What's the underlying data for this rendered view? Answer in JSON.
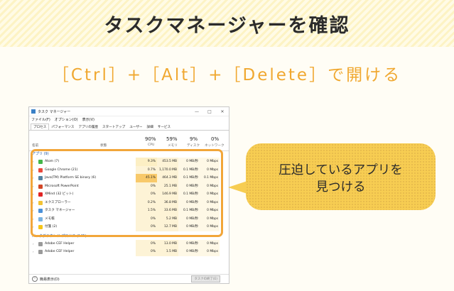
{
  "header": {
    "title": "タスクマネージャーを確認"
  },
  "shortcut": {
    "text": "［Ctrl］+［Alt］+［Delete］で開ける"
  },
  "callout": {
    "text": "圧迫しているアプリを\n見つける"
  },
  "taskmanager": {
    "window_title": "タスク マネージャー",
    "window_controls": [
      "—",
      "□",
      "✕"
    ],
    "menu": [
      "ファイル(F)",
      "オプション(O)",
      "表示(V)"
    ],
    "tabs": [
      "プロセス",
      "パフォーマンス",
      "アプリの履歴",
      "スタートアップ",
      "ユーザー",
      "詳細",
      "サービス"
    ],
    "columns": {
      "name": "名前",
      "status": "状態",
      "cpu": {
        "percent": "90%",
        "label": "CPU"
      },
      "memory": {
        "percent": "59%",
        "label": "メモリ"
      },
      "disk": {
        "percent": "9%",
        "label": "ディスク"
      },
      "network": {
        "percent": "0%",
        "label": "ネットワーク"
      }
    },
    "apps_group": "アプリ (9)",
    "apps": [
      {
        "name": "Atom (7)",
        "cpu": "9.3%",
        "mem": "453.5 MB",
        "disk": "0 MB/秒",
        "net": "0 Mbps",
        "icon_color": "#43b649",
        "cpu_bg": "#fcefc4"
      },
      {
        "name": "Google Chrome (21)",
        "cpu": "0.7%",
        "mem": "1,170.0 MB",
        "disk": "0.1 MB/秒",
        "net": "0 Mbps",
        "icon_color": "#e9483b",
        "cpu_bg": "#fdf3d6"
      },
      {
        "name": "Java(TM) Platform SE binary (6)",
        "cpu": "45.1%",
        "mem": "464.3 MB",
        "disk": "0.1 MB/秒",
        "net": "0.1 Mbps",
        "icon_color": "#5382a1",
        "cpu_bg": "#f8c96a"
      },
      {
        "name": "Microsoft PowerPoint",
        "cpu": "0%",
        "mem": "25.1 MB",
        "disk": "0 MB/秒",
        "net": "0 Mbps",
        "icon_color": "#d24726",
        "cpu_bg": "#fdf3d6"
      },
      {
        "name": "XMind (32 ビット)",
        "cpu": "0%",
        "mem": "146.9 MB",
        "disk": "0.1 MB/秒",
        "net": "0 Mbps",
        "icon_color": "#e02424",
        "cpu_bg": "#fdf3d6"
      },
      {
        "name": "エクスプローラー",
        "cpu": "0.2%",
        "mem": "36.8 MB",
        "disk": "0 MB/秒",
        "net": "0 Mbps",
        "icon_color": "#f2c335",
        "cpu_bg": "#fdf3d6"
      },
      {
        "name": "タスク マネージャー",
        "cpu": "1.5%",
        "mem": "33.6 MB",
        "disk": "0.1 MB/秒",
        "net": "0 Mbps",
        "icon_color": "#4a90d9",
        "cpu_bg": "#fdf3d6"
      },
      {
        "name": "メモ帳",
        "cpu": "0%",
        "mem": "5.2 MB",
        "disk": "0 MB/秒",
        "net": "0 Mbps",
        "icon_color": "#7ab3e0",
        "cpu_bg": "#fdf3d6"
      },
      {
        "name": "付箋 (2)",
        "cpu": "0%",
        "mem": "12.7 MB",
        "disk": "0 MB/秒",
        "net": "0 Mbps",
        "icon_color": "#f5c518",
        "cpu_bg": "#fdf3d6"
      }
    ],
    "background_group": "バックグラウンド プロセス (145)",
    "background": [
      {
        "name": "Adobe CEF Helper",
        "cpu": "0%",
        "mem": "13.0 MB",
        "disk": "0 MB/秒",
        "net": "0 Mbps",
        "icon_color": "#9a9a9a",
        "cpu_bg": "#fdf3d6"
      },
      {
        "name": "Adobe CEF Helper",
        "cpu": "0%",
        "mem": "1.5 MB",
        "disk": "0 MB/秒",
        "net": "0 Mbps",
        "icon_color": "#9a9a9a",
        "cpu_bg": "#fdf3d6"
      }
    ],
    "footer": {
      "less_details": "簡易表示(D)",
      "end_task": "タスクの終了(E)"
    }
  }
}
